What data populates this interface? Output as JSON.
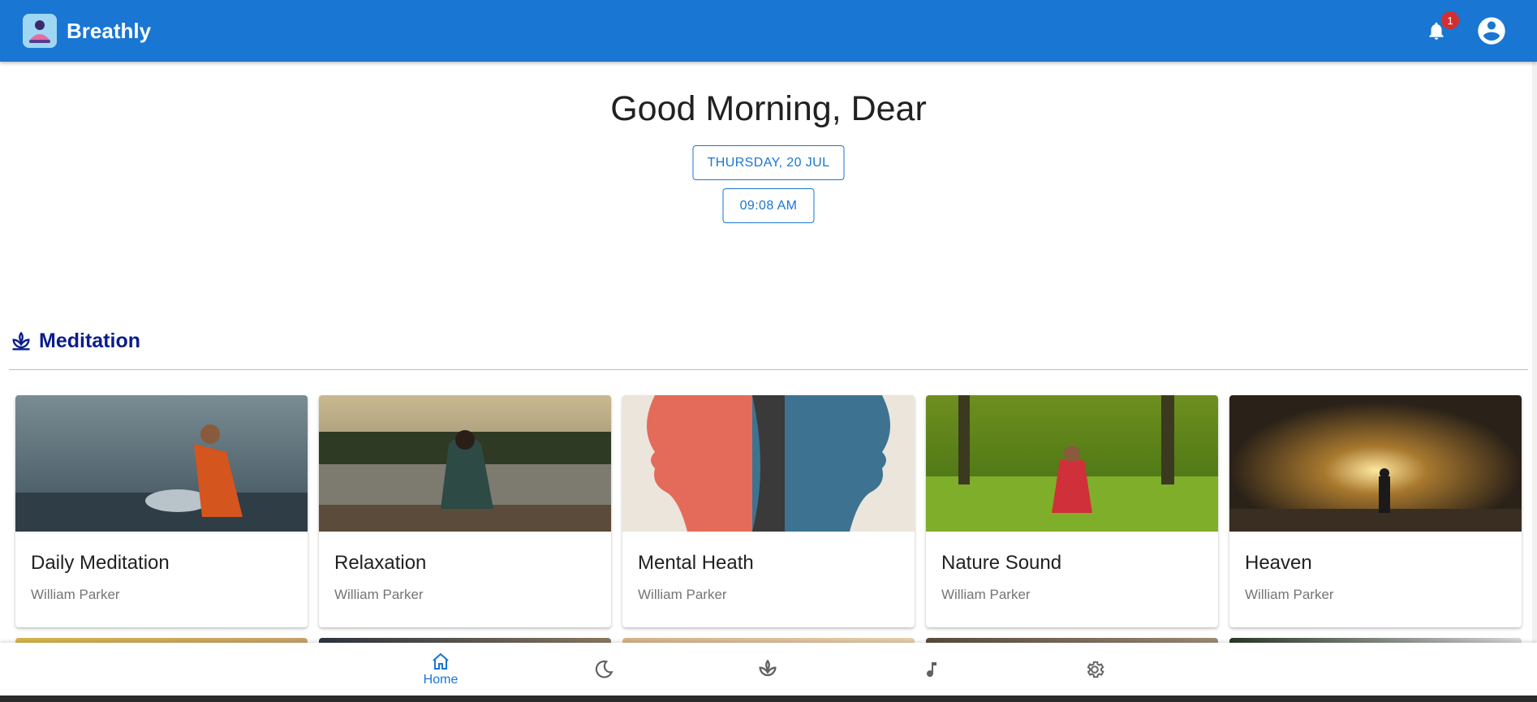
{
  "app": {
    "name": "Breathly",
    "notification_count": "1"
  },
  "greeting": {
    "title": "Good Morning, Dear",
    "date": "THURSDAY, 20 JUL",
    "time": "09:08 AM"
  },
  "section": {
    "title": "Meditation",
    "icon": "lotus-icon"
  },
  "cards": [
    {
      "title": "Daily Meditation",
      "author": "William Parker"
    },
    {
      "title": "Relaxation",
      "author": "William Parker"
    },
    {
      "title": "Mental Heath",
      "author": "William Parker"
    },
    {
      "title": "Nature Sound",
      "author": "William Parker"
    },
    {
      "title": "Heaven",
      "author": "William Parker"
    }
  ],
  "bottom_nav": [
    {
      "label": "Home",
      "icon": "home-icon",
      "active": true
    },
    {
      "label": "",
      "icon": "moon-icon"
    },
    {
      "label": "",
      "icon": "lotus-icon"
    },
    {
      "label": "",
      "icon": "music-note-icon"
    },
    {
      "label": "",
      "icon": "gear-icon"
    }
  ],
  "colors": {
    "primary": "#1976d2",
    "section_title": "#0a1d8c",
    "badge": "#d32f2f"
  }
}
